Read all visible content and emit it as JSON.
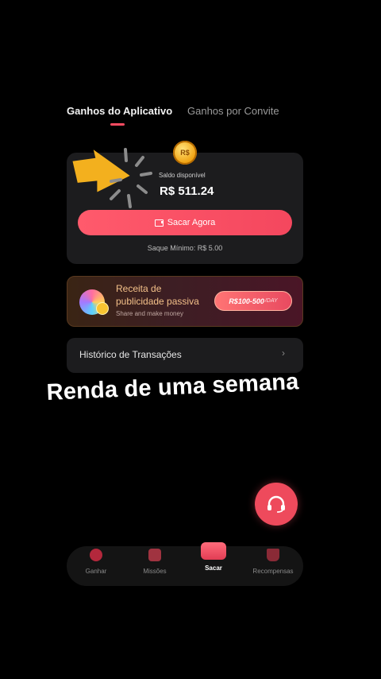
{
  "tabs": [
    {
      "label": "Ganhos do Aplicativo",
      "active": true
    },
    {
      "label": "Ganhos por Convite",
      "active": false
    }
  ],
  "balance": {
    "label": "Saldo disponível",
    "amount": "R$ 511.24",
    "coin_symbol": "R$",
    "withdraw_button": "Sacar Agora",
    "minimum": "Saque Mínimo: R$ 5.00"
  },
  "ad_banner": {
    "title_line1": "Receita de",
    "title_line2": "publicidade passiva",
    "subtitle": "Share and make money",
    "range": "R$100-500",
    "range_unit": "/DAY"
  },
  "history": {
    "label": "Histórico de Transações",
    "chevron": "›"
  },
  "caption": "Renda de uma semana",
  "bottom_nav": [
    {
      "label": "Ganhar",
      "icon": "earn-icon"
    },
    {
      "label": "Missões",
      "icon": "missions-icon"
    },
    {
      "label": "Sacar",
      "icon": "wallet-icon",
      "active": true
    },
    {
      "label": "Recompensas",
      "icon": "trophy-icon"
    }
  ],
  "colors": {
    "accent": "#ff4c62",
    "card": "#1c1c1e",
    "background": "#000000",
    "arrow": "#f3b01e"
  }
}
